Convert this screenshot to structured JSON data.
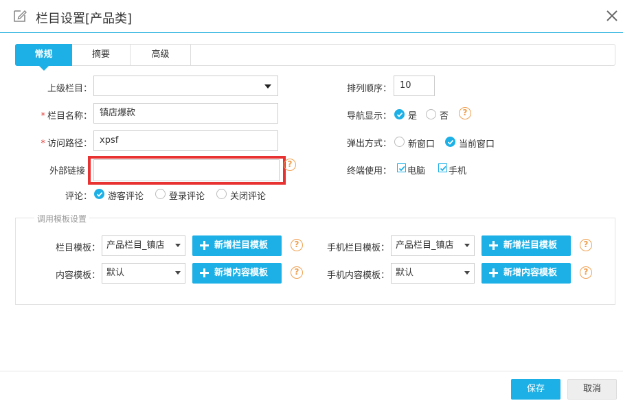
{
  "dialog": {
    "title": "栏目设置[产品类]"
  },
  "tabs": [
    {
      "label": "常规"
    },
    {
      "label": "摘要"
    },
    {
      "label": "高级"
    }
  ],
  "form": {
    "parent_label": "上级栏目：",
    "parent_value": "",
    "name_label": "栏目名称：",
    "name_value": "镇店爆款",
    "path_label": "访问路径：",
    "path_value": "xpsf",
    "external_label": "外部链接",
    "external_value": "",
    "comment_label": "评论：",
    "comment_options": [
      "游客评论",
      "登录评论",
      "关闭评论"
    ],
    "order_label": "排列顺序：",
    "order_value": "10",
    "nav_label": "导航显示：",
    "nav_options": [
      "是",
      "否"
    ],
    "popup_label": "弹出方式：",
    "popup_options": [
      "新窗口",
      "当前窗口"
    ],
    "terminal_label": "终端使用：",
    "terminal_options": [
      "电脑",
      "手机"
    ],
    "required_mark": "*",
    "help_glyph": "?"
  },
  "template": {
    "legend": "调用模板设置",
    "column_label": "栏目模板：",
    "column_value": "产品栏目_镇店",
    "column_add": "新增栏目模板",
    "mobile_column_label": "手机栏目模板：",
    "mobile_column_value": "产品栏目_镇店",
    "mobile_column_add": "新增栏目模板",
    "content_label": "内容模板：",
    "content_value": "默认",
    "content_add": "新增内容模板",
    "mobile_content_label": "手机内容模板：",
    "mobile_content_value": "默认",
    "mobile_content_add": "新增内容模板"
  },
  "footer": {
    "save": "保存",
    "cancel": "取消"
  },
  "colors": {
    "accent": "#1cb0e6",
    "highlight": "#e83232",
    "help": "#f0a050",
    "required": "#e0413c"
  }
}
